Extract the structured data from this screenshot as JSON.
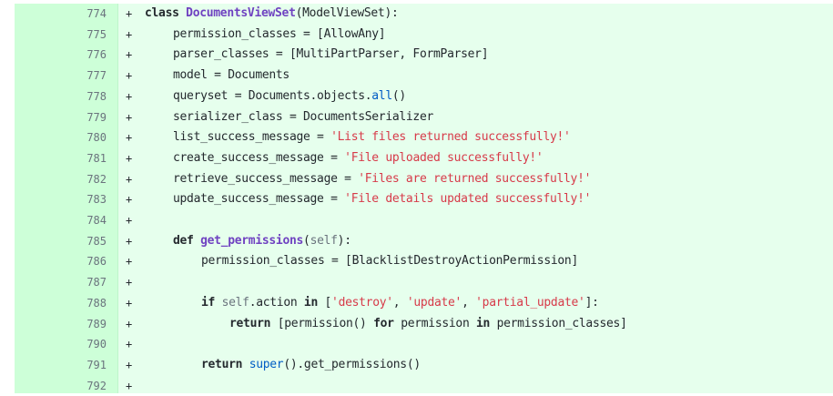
{
  "diff": {
    "lines": [
      {
        "num": "774",
        "marker": "+",
        "indent": "",
        "tokens": [
          {
            "t": "class",
            "k": "kw"
          },
          {
            "t": " ",
            "k": ""
          },
          {
            "t": "DocumentsViewSet",
            "k": "cls"
          },
          {
            "t": "(ModelViewSet):",
            "k": ""
          }
        ]
      },
      {
        "num": "775",
        "marker": "+",
        "indent": "    ",
        "tokens": [
          {
            "t": "permission_classes = [AllowAny]",
            "k": ""
          }
        ]
      },
      {
        "num": "776",
        "marker": "+",
        "indent": "    ",
        "tokens": [
          {
            "t": "parser_classes = [MultiPartParser, FormParser]",
            "k": ""
          }
        ]
      },
      {
        "num": "777",
        "marker": "+",
        "indent": "    ",
        "tokens": [
          {
            "t": "model = Documents",
            "k": ""
          }
        ]
      },
      {
        "num": "778",
        "marker": "+",
        "indent": "    ",
        "tokens": [
          {
            "t": "queryset = Documents.objects.",
            "k": ""
          },
          {
            "t": "all",
            "k": "bi"
          },
          {
            "t": "()",
            "k": ""
          }
        ]
      },
      {
        "num": "779",
        "marker": "+",
        "indent": "    ",
        "tokens": [
          {
            "t": "serializer_class = DocumentsSerializer",
            "k": ""
          }
        ]
      },
      {
        "num": "780",
        "marker": "+",
        "indent": "    ",
        "tokens": [
          {
            "t": "list_success_message = ",
            "k": ""
          },
          {
            "t": "'List files returned successfully!'",
            "k": "str"
          }
        ]
      },
      {
        "num": "781",
        "marker": "+",
        "indent": "    ",
        "tokens": [
          {
            "t": "create_success_message = ",
            "k": ""
          },
          {
            "t": "'File uploaded successfully!'",
            "k": "str"
          }
        ]
      },
      {
        "num": "782",
        "marker": "+",
        "indent": "    ",
        "tokens": [
          {
            "t": "retrieve_success_message = ",
            "k": ""
          },
          {
            "t": "'Files are returned successfully!'",
            "k": "str"
          }
        ]
      },
      {
        "num": "783",
        "marker": "+",
        "indent": "    ",
        "tokens": [
          {
            "t": "update_success_message = ",
            "k": ""
          },
          {
            "t": "'File details updated successfully!'",
            "k": "str"
          }
        ]
      },
      {
        "num": "784",
        "marker": "+",
        "indent": "",
        "tokens": []
      },
      {
        "num": "785",
        "marker": "+",
        "indent": "    ",
        "tokens": [
          {
            "t": "def",
            "k": "kw"
          },
          {
            "t": " ",
            "k": ""
          },
          {
            "t": "get_permissions",
            "k": "fn"
          },
          {
            "t": "(",
            "k": ""
          },
          {
            "t": "self",
            "k": "slf"
          },
          {
            "t": "):",
            "k": ""
          }
        ]
      },
      {
        "num": "786",
        "marker": "+",
        "indent": "        ",
        "tokens": [
          {
            "t": "permission_classes = [BlacklistDestroyActionPermission]",
            "k": ""
          }
        ]
      },
      {
        "num": "787",
        "marker": "+",
        "indent": "",
        "tokens": []
      },
      {
        "num": "788",
        "marker": "+",
        "indent": "        ",
        "tokens": [
          {
            "t": "if",
            "k": "kw"
          },
          {
            "t": " ",
            "k": ""
          },
          {
            "t": "self",
            "k": "slf"
          },
          {
            "t": ".action ",
            "k": ""
          },
          {
            "t": "in",
            "k": "kw"
          },
          {
            "t": " [",
            "k": ""
          },
          {
            "t": "'destroy'",
            "k": "str"
          },
          {
            "t": ", ",
            "k": ""
          },
          {
            "t": "'update'",
            "k": "str"
          },
          {
            "t": ", ",
            "k": ""
          },
          {
            "t": "'partial_update'",
            "k": "str"
          },
          {
            "t": "]:",
            "k": ""
          }
        ]
      },
      {
        "num": "789",
        "marker": "+",
        "indent": "            ",
        "tokens": [
          {
            "t": "return",
            "k": "kw"
          },
          {
            "t": " [permission() ",
            "k": ""
          },
          {
            "t": "for",
            "k": "kw"
          },
          {
            "t": " permission ",
            "k": ""
          },
          {
            "t": "in",
            "k": "kw"
          },
          {
            "t": " permission_classes]",
            "k": ""
          }
        ]
      },
      {
        "num": "790",
        "marker": "+",
        "indent": "",
        "tokens": []
      },
      {
        "num": "791",
        "marker": "+",
        "indent": "        ",
        "tokens": [
          {
            "t": "return",
            "k": "kw"
          },
          {
            "t": " ",
            "k": ""
          },
          {
            "t": "super",
            "k": "bi"
          },
          {
            "t": "().get_permissions()",
            "k": ""
          }
        ]
      },
      {
        "num": "792",
        "marker": "+",
        "indent": "",
        "tokens": []
      }
    ]
  },
  "colors": {
    "added_bg": "#e6ffed",
    "gutter_bg": "#cdffd8",
    "string": "#d73a49",
    "class_name": "#6f42c1",
    "builtin": "#005cc5"
  }
}
